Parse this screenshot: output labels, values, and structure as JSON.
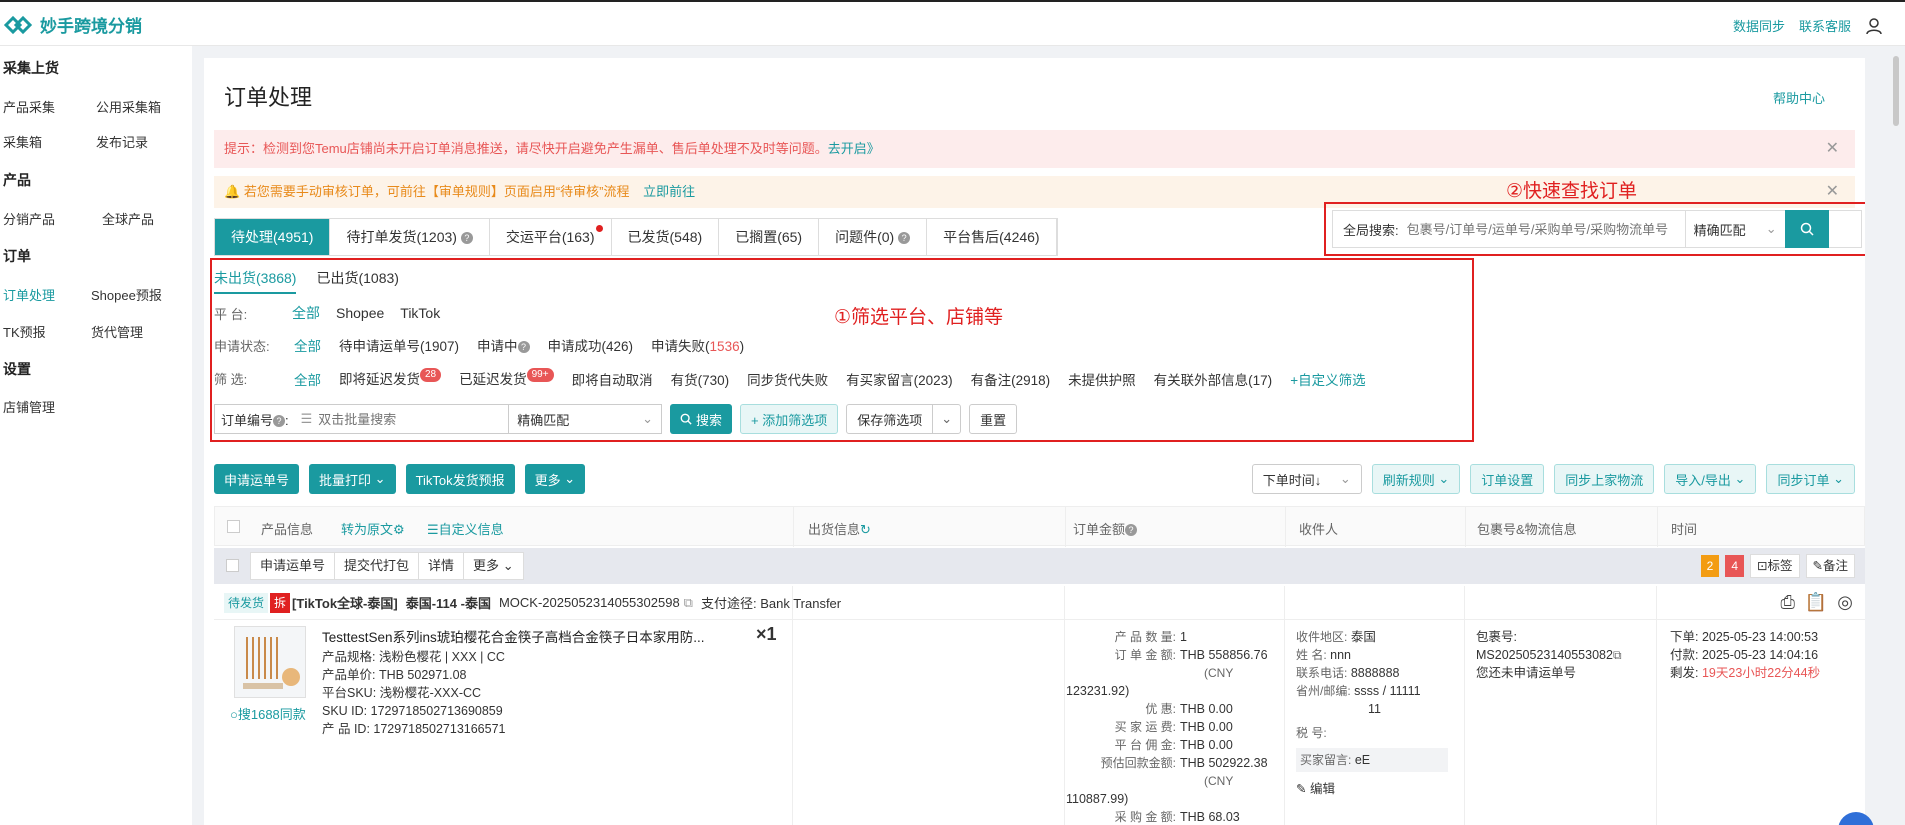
{
  "app": {
    "name": "妙手跨境分销"
  },
  "topbar": {
    "sync": "数据同步",
    "support": "联系客服"
  },
  "sidebar": {
    "sections": [
      {
        "title": "采集上货",
        "items": [
          "产品采集",
          "公用采集箱",
          "采集箱",
          "发布记录"
        ]
      },
      {
        "title": "产品",
        "items": [
          "分销产品",
          "全球产品"
        ]
      },
      {
        "title": "订单",
        "items": [
          "订单处理",
          "Shopee预报",
          "TK预报",
          "货代管理"
        ]
      },
      {
        "title": "设置",
        "items": [
          "店铺管理"
        ]
      }
    ]
  },
  "page": {
    "title": "订单处理",
    "help": "帮助中心"
  },
  "tips": {
    "warning": "提示：检测到您Temu店铺尚未开启订单消息推送，请尽快开启避免产生漏单、售后单处理不及时等问题。",
    "warning_link": "去开启》",
    "notice": "若您需要手动审核订单，可前往【审单规则】页面启用“待审核”流程",
    "notice_link": "立即前往",
    "close": "✕"
  },
  "annotations": {
    "quick_find": "②快速查找订单",
    "filter": "①筛选平台、店铺等"
  },
  "status_tabs": [
    "待处理(4951)",
    "待打单发货(1203)",
    "交运平台(163)",
    "已发货(548)",
    "已搁置(65)",
    "问题件(0)",
    "平台售后(4246)"
  ],
  "global_search": {
    "label": "全局搜索:",
    "placeholder": "包裹号/订单号/运单号/采购单号/采购物流单号",
    "match": "精确匹配"
  },
  "sub_tabs": [
    "未出货(3868)",
    "已出货(1083)"
  ],
  "filters": {
    "platform": {
      "label": "平 台:",
      "options": [
        "全部",
        "Shopee",
        "TikTok"
      ]
    },
    "apply_status": {
      "label": "申请状态:",
      "options": [
        "全部",
        "待申请运单号(1907)",
        "申请中",
        "申请成功(426)",
        "申请失败("
      ],
      "fail_count": "1536",
      "close_paren": ")"
    },
    "screen": {
      "label": "筛 选:",
      "options": [
        "全部",
        "即将延迟发货",
        "已延迟发货",
        "即将自动取消",
        "有货(730)",
        "同步货代失败",
        "有买家留言(2023)",
        "有备注(2918)",
        "未提供护照",
        "有关联外部信息(17)",
        "+自定义筛选"
      ],
      "badge_soon": "28",
      "badge_late": "99+"
    }
  },
  "search_row": {
    "order_no_label": "订单编号",
    "placeholder": "双击批量搜索",
    "match": "精确匹配",
    "search": "搜索",
    "add_filter": "+ 添加筛选项",
    "save_filter": "保存筛选项",
    "reset": "重置"
  },
  "toolbar": {
    "left": [
      "申请运单号",
      "批量打印",
      "TikTok发货预报",
      "更多"
    ],
    "right": [
      "下单时间↓",
      "刷新规则",
      "订单设置",
      "同步上家物流",
      "导入/导出",
      "同步订单"
    ]
  },
  "table_header": {
    "product": "产品信息",
    "to_original": "转为原文",
    "custom_info": "自定义信息",
    "shipping": "出货信息",
    "amount": "订单金额",
    "receiver": "收件人",
    "package": "包裹号&物流信息",
    "time": "时间"
  },
  "batch_row": {
    "buttons": [
      "申请运单号",
      "提交代打包",
      "详情",
      "更多"
    ],
    "count_orange": "2",
    "count_red": "4",
    "tag_btn": "标签",
    "note_btn": "备注"
  },
  "order": {
    "status": "待发货",
    "split": "拆",
    "shop": "[TikTok全球-泰国]",
    "store": "泰国-114 -泰国",
    "order_no": "MOCK-2025052314055302598",
    "payment": "支付途径: Bank Transfer",
    "product_title": "TesttestSen系列ins琥珀樱花合金筷子高档合金筷子日本家用防...",
    "quantity": "×1",
    "spec": "产品规格: 浅粉色樱花 | XXX | CC",
    "unit_price": "产品单价: THB 502971.08",
    "platform_sku": "平台SKU: 浅粉樱花-XXX-CC",
    "sku_id": "SKU ID: 1729718502713690859",
    "product_id": "产 品 ID: 1729718502713166571",
    "search_1688": "搜1688同款",
    "amounts": [
      {
        "k": "产 品 数 量:",
        "v": "1"
      },
      {
        "k": "订 单 金 额:",
        "v": "THB 558856.76"
      },
      {
        "k": "",
        "v": "(CNY"
      },
      {
        "k": "123231.92)",
        "v": ""
      },
      {
        "k": "优 惠:",
        "v": "THB 0.00"
      },
      {
        "k": "买 家 运 费:",
        "v": "THB 0.00"
      },
      {
        "k": "平 台 佣 金:",
        "v": "THB 0.00"
      },
      {
        "k": "预估回款金额:",
        "v": "THB 502922.38"
      },
      {
        "k": "",
        "v": "(CNY"
      },
      {
        "k": "110887.99)",
        "v": ""
      },
      {
        "k": "采 购 金 额:",
        "v": "THB 68.03"
      }
    ],
    "receiver": [
      {
        "k": "收件地区:",
        "v": "泰国"
      },
      {
        "k": "姓 名:",
        "v": "nnn"
      },
      {
        "k": "联系电话:",
        "v": "8888888"
      },
      {
        "k": "省州/邮编:",
        "v": "ssss / 11111"
      },
      {
        "k": "",
        "v": "11"
      },
      {
        "k": "税 号:",
        "v": ""
      }
    ],
    "buyer_note_label": "买家留言:",
    "buyer_note": "eE",
    "edit": "编辑",
    "package_label": "包裹号:",
    "package_no": "MS20250523140553082",
    "no_waybill": "您还未申请运单号",
    "order_time": "下单: 2025-05-23 14:00:53",
    "pay_time": "付款: 2025-05-23 14:04:16",
    "remain_label": "剩发:",
    "remain": "19天23小时22分44秒"
  }
}
